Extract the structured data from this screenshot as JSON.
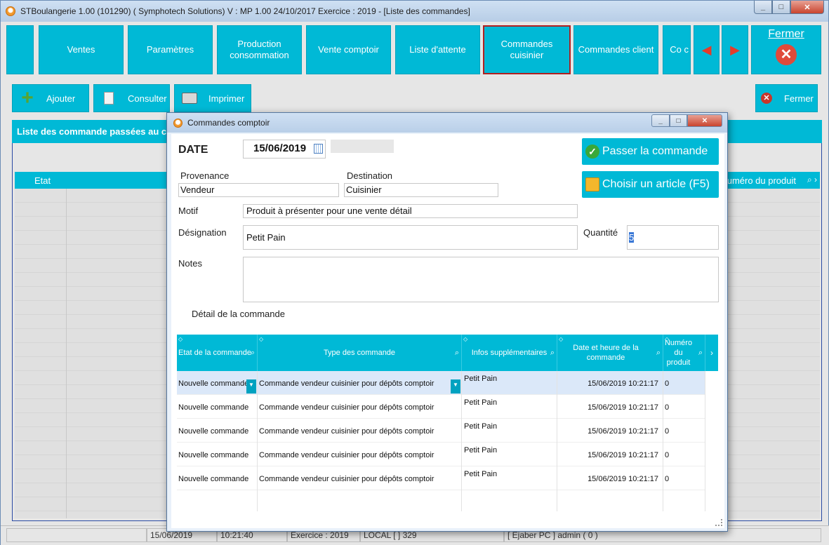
{
  "window": {
    "title": "STBoulangerie 1.00 (101290) ( Symphotech Solutions)  V : MP 1.00 24/10/2017 Exercice : 2019 - [Liste des commandes]",
    "min": "_",
    "max": "□",
    "close": "✕"
  },
  "ribbon": {
    "ventes": "Ventes",
    "parametres": "Paramètres",
    "production": "Production consommation",
    "vente_comptoir": "Vente comptoir",
    "liste_attente": "Liste d'attente",
    "commandes_cuisinier": "Commandes cuisinier",
    "commandes_client": "Commandes client",
    "partial": "Co c",
    "prev": "◀",
    "next": "▶",
    "fermer": "Fermer"
  },
  "toolbar": {
    "ajouter": "Ajouter",
    "consulter": "Consulter",
    "imprimer": "Imprimer",
    "fermer": "Fermer"
  },
  "list": {
    "header": "Liste des commande passées au c",
    "col_etat": "Etat",
    "col_num": "uméro du produit"
  },
  "statusbar": {
    "date": "15/06/2019",
    "time": "10:21:40",
    "exercice": "Exercice : 2019",
    "local": "LOCAL [ ] 329",
    "user": "[ Ejaber PC ] admin ( 0 )"
  },
  "dialog": {
    "title": "Commandes comptoir",
    "date_label": "DATE",
    "date_value": "15/06/2019",
    "provenance_label": "Provenance",
    "provenance_value": "Vendeur",
    "destination_label": "Destination",
    "destination_value": "Cuisinier",
    "motif_label": "Motif",
    "motif_value": "Produit à présenter pour une vente détail",
    "designation_label": "Désignation",
    "designation_value": "Petit Pain",
    "quantite_label": "Quantité",
    "quantite_value": "5",
    "notes_label": "Notes",
    "notes_value": "",
    "detail_label": "Détail de la commande",
    "passer_btn": "Passer la commande",
    "choisir_btn": "Choisir un article (F5)"
  },
  "detail_grid": {
    "headers": {
      "etat": "Etat de la commande",
      "type": "Type des commande",
      "infos": "Infos supplémentaires",
      "date": "Date et heure de la commande",
      "num": "Numéro du produit"
    },
    "rows": [
      {
        "etat": "Nouvelle commande",
        "type": "Commande vendeur cuisinier pour dépôts comptoir",
        "infos": "Petit Pain",
        "date": "15/06/2019 10:21:17",
        "num": "0"
      },
      {
        "etat": "Nouvelle commande",
        "type": "Commande vendeur cuisinier pour dépôts comptoir",
        "infos": "Petit Pain",
        "date": "15/06/2019 10:21:17",
        "num": "0"
      },
      {
        "etat": "Nouvelle commande",
        "type": "Commande vendeur cuisinier pour dépôts comptoir",
        "infos": "Petit Pain",
        "date": "15/06/2019 10:21:17",
        "num": "0"
      },
      {
        "etat": "Nouvelle commande",
        "type": "Commande vendeur cuisinier pour dépôts comptoir",
        "infos": "Petit Pain",
        "date": "15/06/2019 10:21:17",
        "num": "0"
      },
      {
        "etat": "Nouvelle commande",
        "type": "Commande vendeur cuisinier pour dépôts comptoir",
        "infos": "Petit Pain",
        "date": "15/06/2019 10:21:17",
        "num": "0"
      }
    ]
  }
}
